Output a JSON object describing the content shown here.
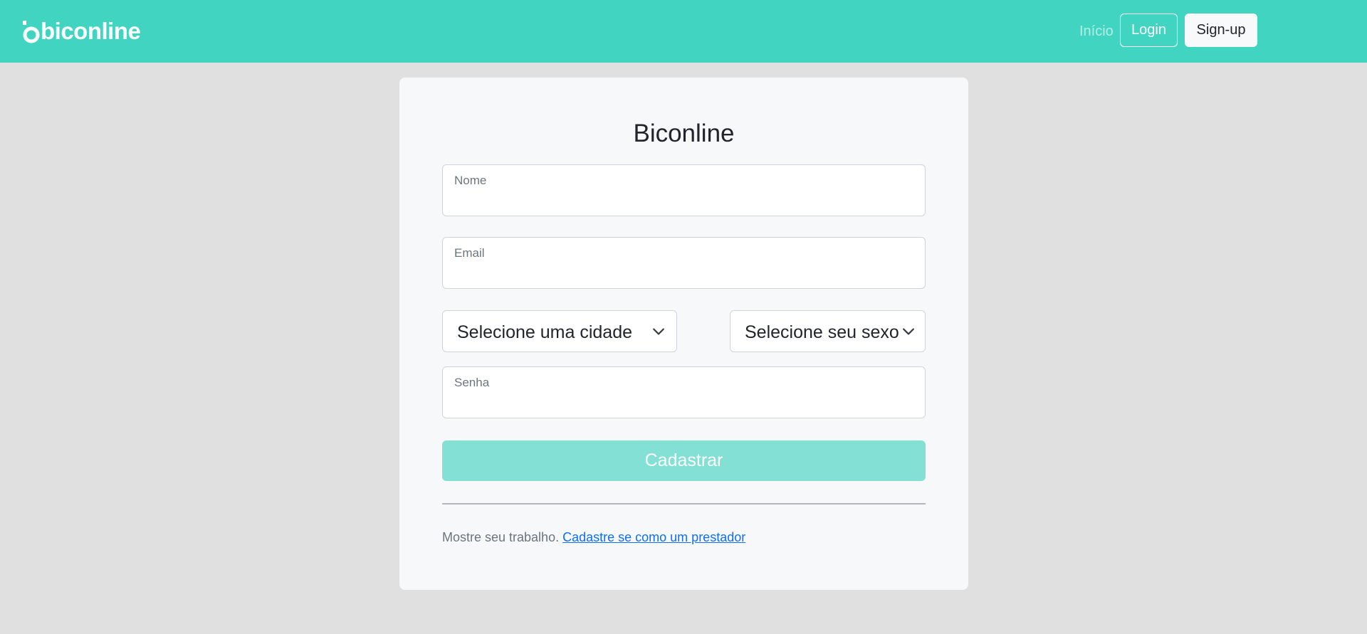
{
  "navbar": {
    "brand": "biconline",
    "links": {
      "home": "Início",
      "login": "Login",
      "signup": "Sign-up"
    }
  },
  "form": {
    "title": "Biconline",
    "name_label": "Nome",
    "email_label": "Email",
    "city_select": "Selecione uma cidade",
    "gender_select": "Selecione seu sexo",
    "password_label": "Senha",
    "submit_label": "Cadastrar"
  },
  "footer": {
    "text": "Mostre seu trabalho.",
    "link": "Cadastre se como um prestador"
  },
  "colors": {
    "brand": "#41d5c1",
    "submit_button": "#83e0d4",
    "link": "#0d6efd",
    "page_background": "#e0e0e0",
    "card_background": "#f7f8fa"
  },
  "icons": [
    "brand-logo-icon",
    "chevron-down-icon"
  ]
}
